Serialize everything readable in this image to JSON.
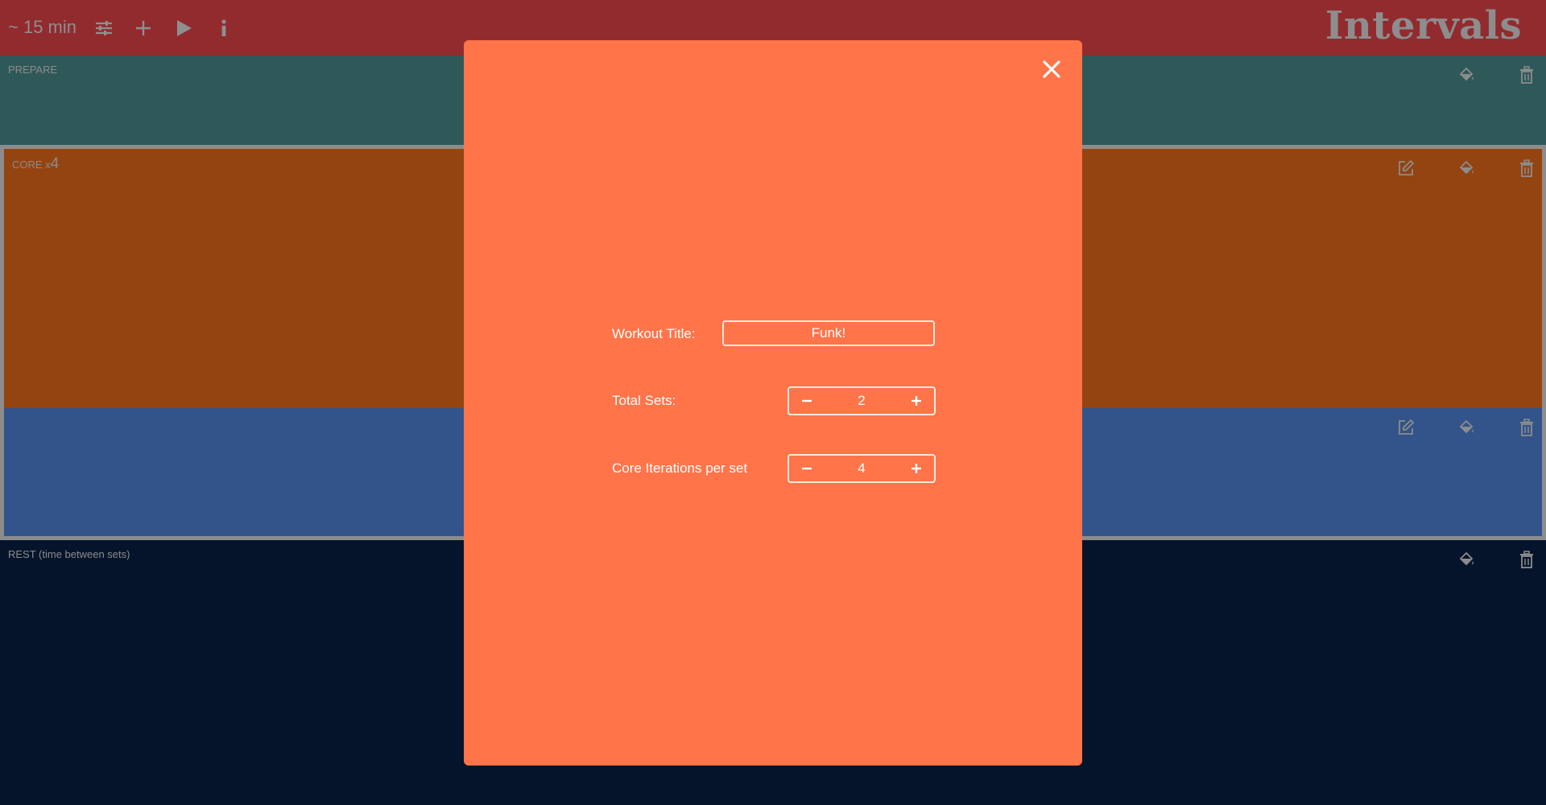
{
  "topbar": {
    "duration": "~ 15 min",
    "app_title": "Intervals",
    "icons": [
      "settings-sliders-icon",
      "plus-icon",
      "play-icon",
      "info-icon"
    ]
  },
  "sections": {
    "prepare": {
      "label": "PREPARE",
      "color": "#2f5858"
    },
    "core": {
      "label": "CORE x",
      "multiplier": "4",
      "color": "#944410"
    },
    "blue": {
      "label": "",
      "color": "#32548a"
    },
    "rest": {
      "label": "REST (time between sets)",
      "color": "#06142b"
    }
  },
  "modal": {
    "background": "#ff7449",
    "workout_title_label": "Workout Title:",
    "workout_title_value": "Funk!",
    "total_sets_label": "Total Sets:",
    "total_sets_value": "2",
    "core_iterations_label": "Core Iterations per set",
    "core_iterations_value": "4"
  }
}
